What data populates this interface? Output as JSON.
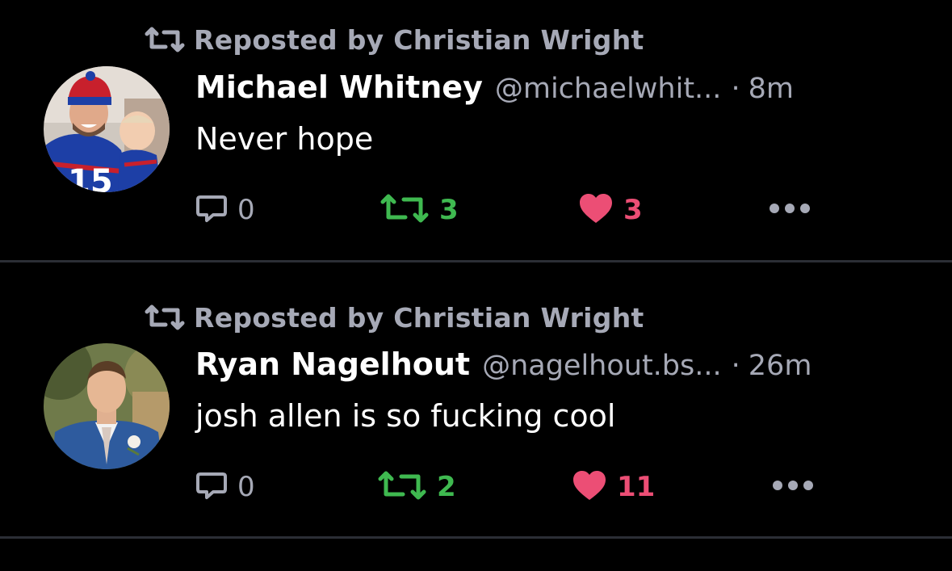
{
  "colors": {
    "background": "#000000",
    "divider": "#2b2e35",
    "muted_text": "#a6a9b6",
    "repost_green": "#3fb950",
    "like_pink": "#ec4e75"
  },
  "posts": [
    {
      "repost_label": "Reposted by Christian Wright",
      "display_name": "Michael Whitney",
      "handle": "@michaelwhit...",
      "separator": "·",
      "time": "8m",
      "text": "Never hope",
      "reply_count": "0",
      "repost_count": "3",
      "like_count": "3",
      "icons": {
        "repost": "repost-icon",
        "reply": "speech-bubble-icon",
        "like": "heart-icon",
        "more": "ellipsis-icon"
      }
    },
    {
      "repost_label": "Reposted by Christian Wright",
      "display_name": "Ryan Nagelhout",
      "handle": "@nagelhout.bs...",
      "separator": "·",
      "time": "26m",
      "text": "josh allen is so fucking cool",
      "reply_count": "0",
      "repost_count": "2",
      "like_count": "11",
      "icons": {
        "repost": "repost-icon",
        "reply": "speech-bubble-icon",
        "like": "heart-icon",
        "more": "ellipsis-icon"
      }
    }
  ]
}
